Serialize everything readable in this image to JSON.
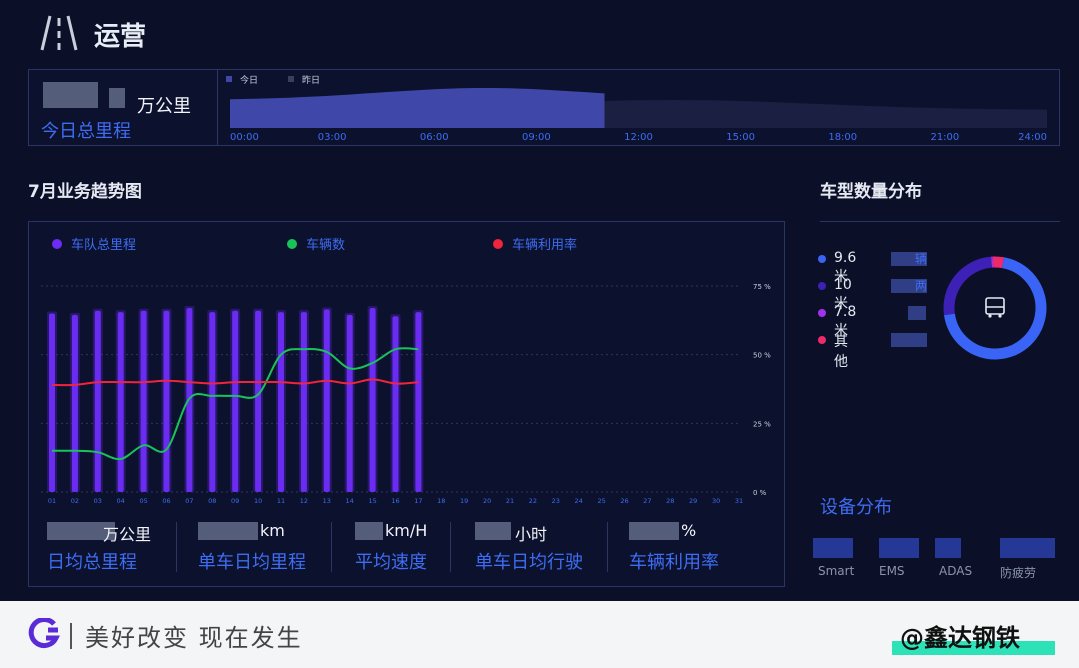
{
  "header": {
    "title": "运营"
  },
  "mileage": {
    "unit": "万公里",
    "label": "今日总里程",
    "legend": [
      "今日",
      "昨日"
    ],
    "x_ticks": [
      "00:00",
      "03:00",
      "06:00",
      "09:00",
      "12:00",
      "15:00",
      "18:00",
      "21:00",
      "24:00"
    ]
  },
  "trend": {
    "title": "7月业务趋势图",
    "legend": [
      {
        "label": "车队总里程",
        "color": "#6d2cf5"
      },
      {
        "label": "车辆数",
        "color": "#19c35a"
      },
      {
        "label": "车辆利用率",
        "color": "#f0243a"
      }
    ],
    "y_ticks": [
      "0 %",
      "25 %",
      "50 %",
      "75 %"
    ],
    "stats": [
      {
        "unit": "万公里",
        "label": "日均总里程"
      },
      {
        "unit": "km",
        "label": "单车日均里程"
      },
      {
        "unit": "km/H",
        "label": "平均速度"
      },
      {
        "unit": "小时",
        "label": "单车日均行驶"
      },
      {
        "unit": "%",
        "label": "车辆利用率"
      }
    ]
  },
  "chart_data": {
    "type": "bar",
    "categories": [
      "01",
      "02",
      "03",
      "04",
      "05",
      "06",
      "07",
      "08",
      "09",
      "10",
      "11",
      "12",
      "13",
      "14",
      "15",
      "16",
      "17",
      "18",
      "19",
      "20",
      "21",
      "22",
      "23",
      "24",
      "25",
      "26",
      "27",
      "28",
      "29",
      "30",
      "31"
    ],
    "ylim": [
      0,
      75
    ],
    "series": [
      {
        "name": "车队总里程",
        "type": "bar",
        "values": [
          65,
          64.5,
          66,
          65.5,
          66,
          66,
          67,
          65.5,
          66,
          66,
          65.5,
          65.5,
          66.5,
          64.5,
          67,
          64,
          65.5,
          null,
          null,
          null,
          null,
          null,
          null,
          null,
          null,
          null,
          null,
          null,
          null,
          null,
          null
        ]
      },
      {
        "name": "车辆数",
        "type": "line",
        "values": [
          15,
          15,
          14.5,
          12,
          17,
          15.5,
          34,
          35,
          35,
          35.5,
          50,
          52,
          51,
          45,
          47,
          52,
          52,
          null,
          null,
          null,
          null,
          null,
          null,
          null,
          null,
          null,
          null,
          null,
          null,
          null,
          null
        ]
      },
      {
        "name": "车辆利用率",
        "type": "line",
        "values": [
          39,
          39,
          40,
          40,
          40,
          40.5,
          40,
          39.5,
          40,
          40,
          40,
          39.5,
          40.5,
          39.5,
          41,
          39.5,
          40,
          null,
          null,
          null,
          null,
          null,
          null,
          null,
          null,
          null,
          null,
          null,
          null,
          null,
          null
        ]
      }
    ]
  },
  "vehicle_types": {
    "title": "车型数量分布",
    "items": [
      {
        "name": "9.6米",
        "color": "#3a64f5",
        "tail": "辆",
        "share": 70
      },
      {
        "name": "10米",
        "color": "#3d20b5",
        "tail": "两",
        "share": 26
      },
      {
        "name": "7.8米",
        "color": "#a531f0",
        "tail": "",
        "share": 0.5
      },
      {
        "name": "其他",
        "color": "#ef2a6b",
        "tail": "",
        "share": 3.5
      }
    ]
  },
  "devices": {
    "title": "设备分布",
    "items": [
      "Smart",
      "EMS",
      "ADAS",
      "防疲劳"
    ]
  },
  "footer": {
    "slogan": "美好改变 现在发生",
    "handle": "@鑫达钢铁"
  }
}
